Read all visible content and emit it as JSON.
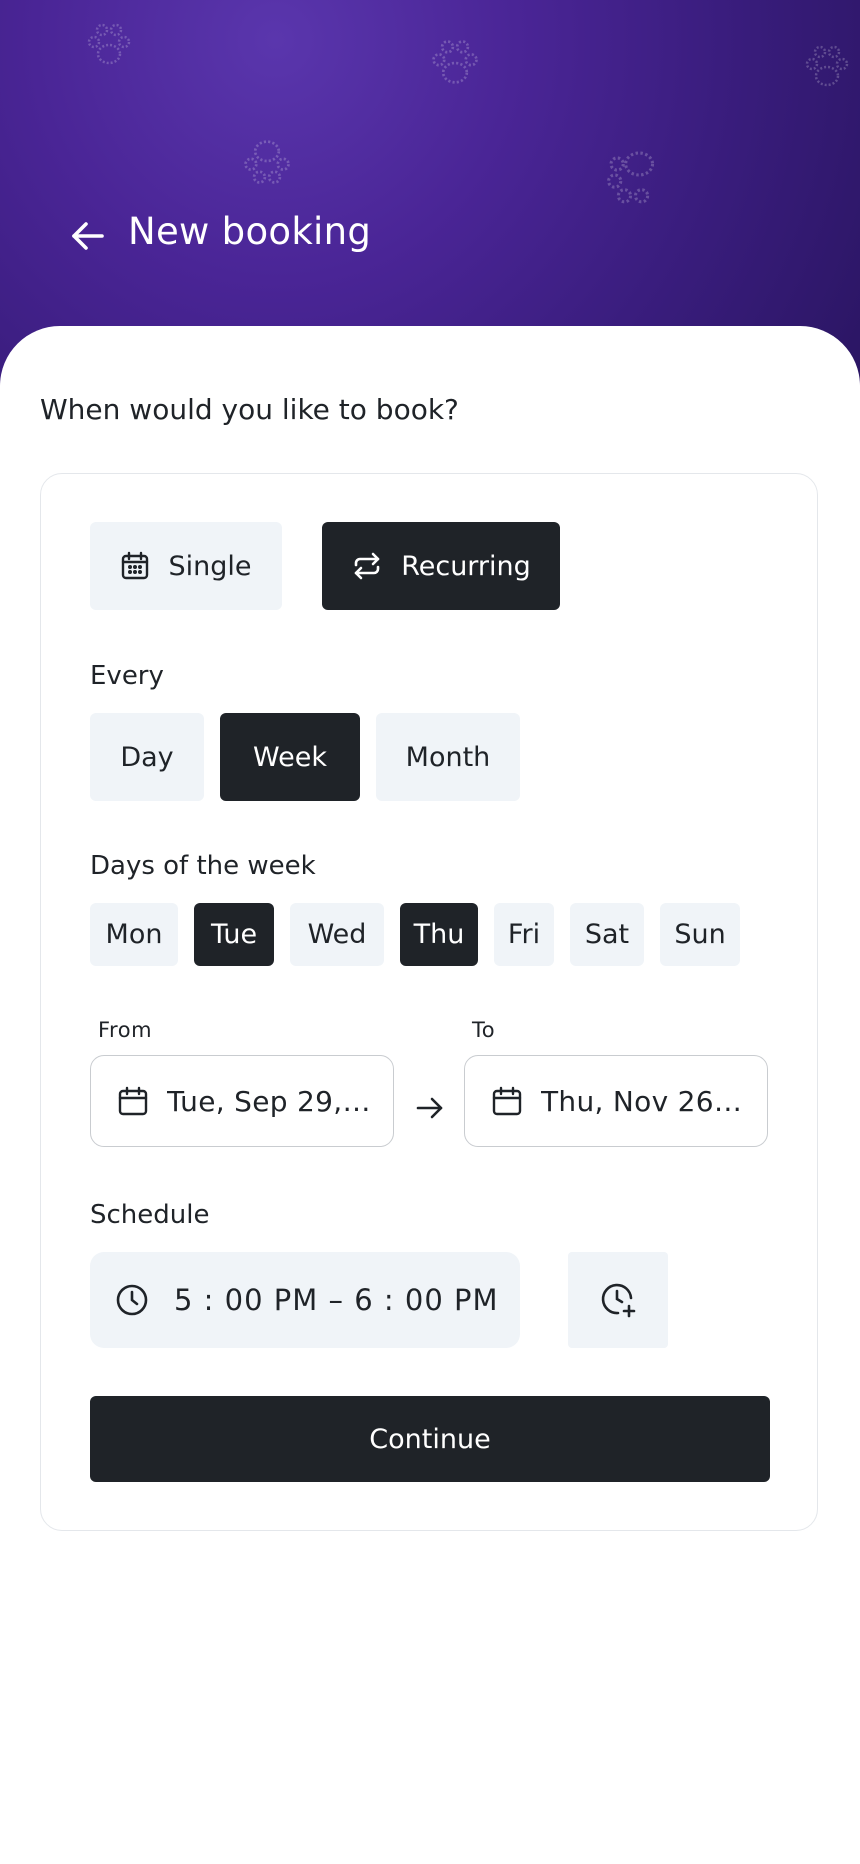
{
  "header": {
    "title": "New booking",
    "gradient_colors": [
      "#5a36ad",
      "#2a1562"
    ]
  },
  "question": "When would you like to book?",
  "booking_type": {
    "options": [
      {
        "label": "Single",
        "icon": "calendar-icon",
        "selected": false
      },
      {
        "label": "Recurring",
        "icon": "repeat-icon",
        "selected": true
      }
    ]
  },
  "frequency": {
    "label": "Every",
    "options": [
      {
        "label": "Day",
        "selected": false
      },
      {
        "label": "Week",
        "selected": true
      },
      {
        "label": "Month",
        "selected": false
      }
    ]
  },
  "days": {
    "label": "Days of the week",
    "options": [
      {
        "label": "Mon",
        "selected": false
      },
      {
        "label": "Tue",
        "selected": true
      },
      {
        "label": "Wed",
        "selected": false
      },
      {
        "label": "Thu",
        "selected": true
      },
      {
        "label": "Fri",
        "selected": false
      },
      {
        "label": "Sat",
        "selected": false
      },
      {
        "label": "Sun",
        "selected": false
      }
    ]
  },
  "range": {
    "from_label": "From",
    "from_value": "Tue, Sep 29, 2…",
    "to_label": "To",
    "to_value": "Thu, Nov 26, 2…"
  },
  "schedule": {
    "label": "Schedule",
    "time_value": "5 : 00   PM – 6 : 00   PM"
  },
  "continue_label": "Continue",
  "colors": {
    "dark": "#1f2328",
    "light": "#f0f4f8",
    "border": "#e4e7eb"
  }
}
